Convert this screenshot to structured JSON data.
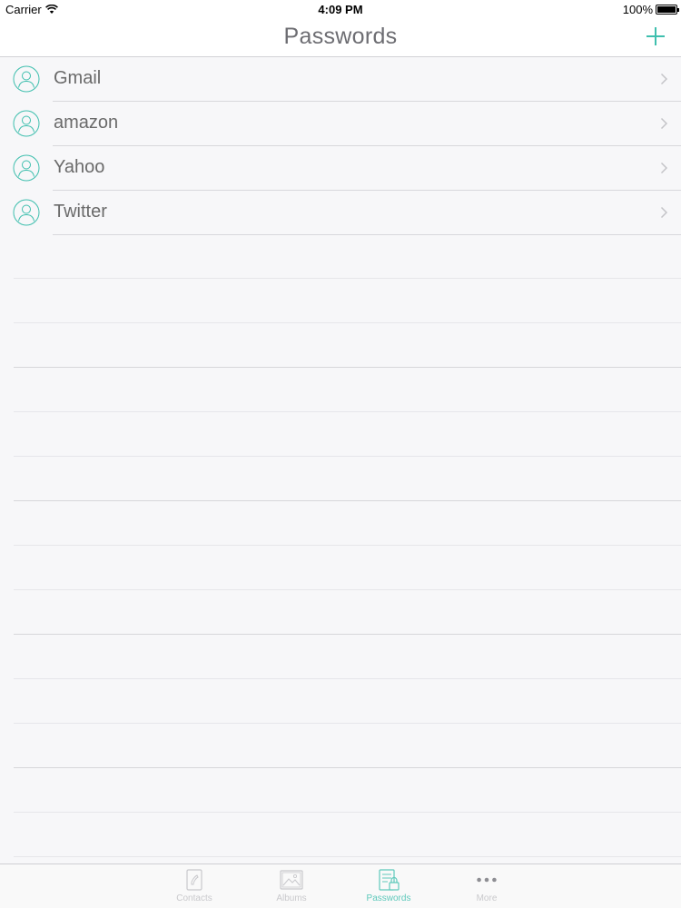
{
  "status_bar": {
    "carrier": "Carrier",
    "time": "4:09 PM",
    "battery": "100%"
  },
  "nav": {
    "title": "Passwords",
    "add_icon": "plus-icon"
  },
  "colors": {
    "accent": "#3fbfae",
    "text": "#6a6a6a",
    "separator": "#d8d8dc",
    "background": "#f7f7f9"
  },
  "items": [
    {
      "label": "Gmail",
      "icon": "person-icon"
    },
    {
      "label": "amazon",
      "icon": "person-icon"
    },
    {
      "label": "Yahoo",
      "icon": "person-icon"
    },
    {
      "label": "Twitter",
      "icon": "person-icon"
    }
  ],
  "tabs": [
    {
      "label": "Contacts",
      "icon": "contacts-icon",
      "active": false
    },
    {
      "label": "Albums",
      "icon": "albums-icon",
      "active": false
    },
    {
      "label": "Passwords",
      "icon": "passwords-icon",
      "active": true
    },
    {
      "label": "More",
      "icon": "more-icon",
      "active": false
    }
  ]
}
